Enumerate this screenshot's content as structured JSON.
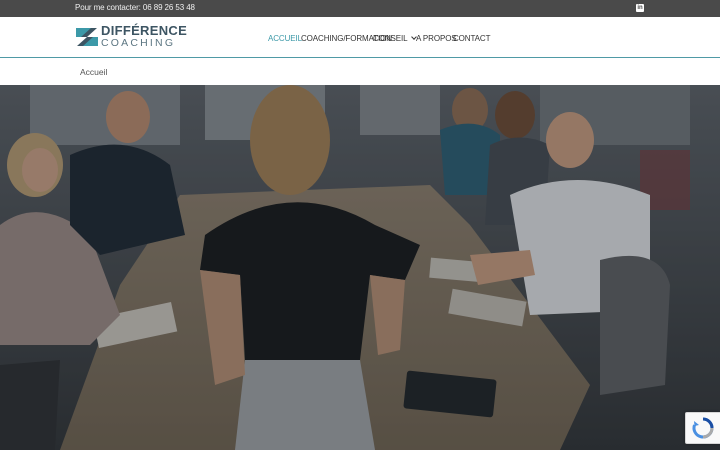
{
  "topbar": {
    "contact": "Pour me contacter: 06 89 26 53 48",
    "social_icon": "linkedin-icon",
    "social_letters": "in"
  },
  "brand": {
    "name_line1": "DIFFÉRENCE",
    "name_line2": "COACHING",
    "color": "#3d5563",
    "accent": "#3c99a8"
  },
  "nav": {
    "items": [
      {
        "label": "ACCUEIL",
        "active": true
      },
      {
        "label": "COACHING/FORMATION",
        "active": false
      },
      {
        "label": "CONSEIL",
        "active": false,
        "has_dropdown": true
      },
      {
        "label": "A PROPOS",
        "active": false
      },
      {
        "label": "CONTACT",
        "active": false
      }
    ]
  },
  "breadcrumb": {
    "current": "Accueil"
  },
  "hero": {
    "image": "meeting-room-photo",
    "description_hidden": true
  },
  "recaptcha": {
    "icon": "recaptcha-icon"
  }
}
